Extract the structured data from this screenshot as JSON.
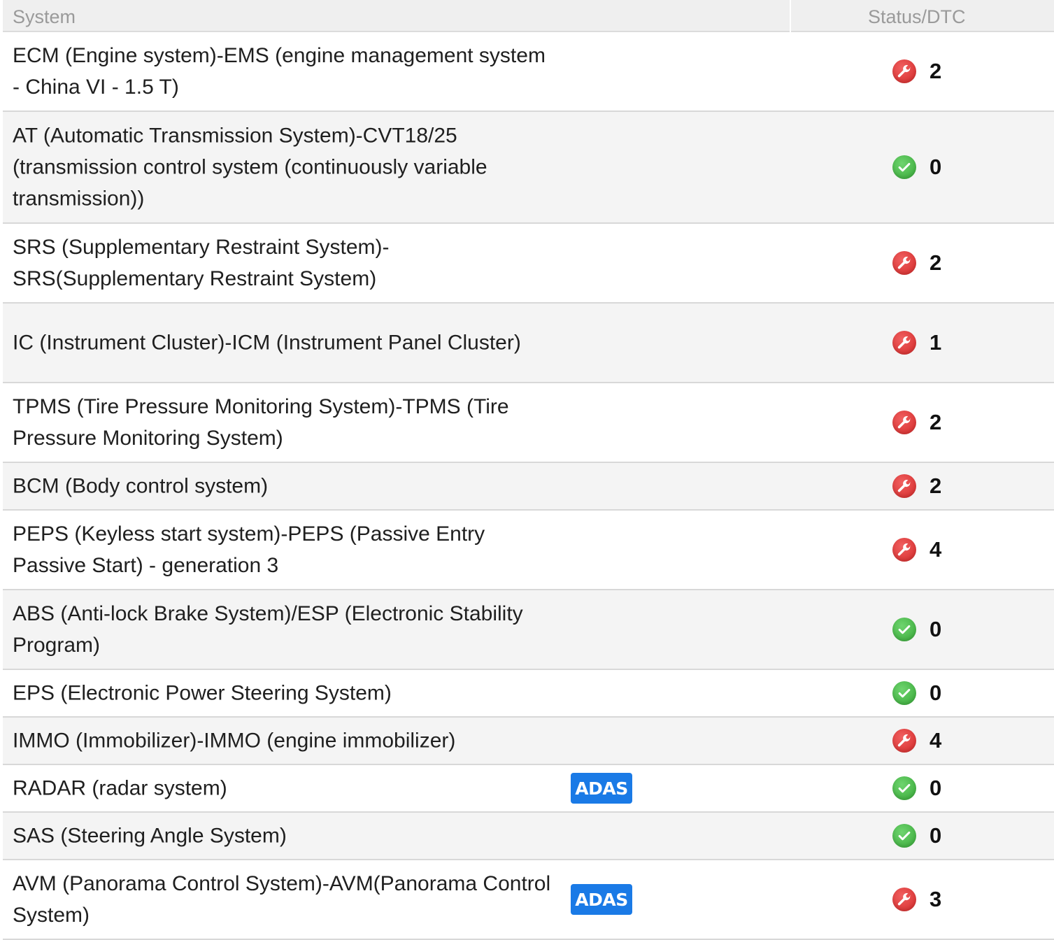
{
  "header": {
    "system_label": "System",
    "status_label": "Status/DTC"
  },
  "rows": [
    {
      "name": "ECM (Engine system)-EMS (engine management system - China VI - 1.5 T)",
      "status": "fault",
      "icon": "wrench-icon",
      "count": "2",
      "adas": ""
    },
    {
      "name": "AT (Automatic Transmission System)-CVT18/25 (transmission control system (continuously variable transmission))",
      "status": "ok",
      "icon": "check-icon",
      "count": "0",
      "adas": ""
    },
    {
      "name": "SRS (Supplementary Restraint System)-SRS(Supplementary Restraint System)",
      "status": "fault",
      "icon": "wrench-icon",
      "count": "2",
      "adas": ""
    },
    {
      "name": "IC (Instrument Cluster)-ICM (Instrument Panel Cluster)",
      "status": "fault",
      "icon": "wrench-icon",
      "count": "1",
      "adas": ""
    },
    {
      "name": "TPMS (Tire Pressure Monitoring System)-TPMS (Tire Pressure Monitoring System)",
      "status": "fault",
      "icon": "wrench-icon",
      "count": "2",
      "adas": ""
    },
    {
      "name": "BCM (Body control system)",
      "status": "fault",
      "icon": "wrench-icon",
      "count": "2",
      "adas": ""
    },
    {
      "name": "PEPS (Keyless start system)-PEPS (Passive Entry Passive Start) - generation 3",
      "status": "fault",
      "icon": "wrench-icon",
      "count": "4",
      "adas": ""
    },
    {
      "name": "ABS (Anti-lock Brake System)/ESP (Electronic Stability Program)",
      "status": "ok",
      "icon": "check-icon",
      "count": "0",
      "adas": ""
    },
    {
      "name": "EPS (Electronic Power Steering System)",
      "status": "ok",
      "icon": "check-icon",
      "count": "0",
      "adas": ""
    },
    {
      "name": "IMMO (Immobilizer)-IMMO (engine immobilizer)",
      "status": "fault",
      "icon": "wrench-icon",
      "count": "4",
      "adas": ""
    },
    {
      "name": "RADAR (radar system)",
      "status": "ok",
      "icon": "check-icon",
      "count": "0",
      "adas": "ADAS"
    },
    {
      "name": "SAS (Steering Angle System)",
      "status": "ok",
      "icon": "check-icon",
      "count": "0",
      "adas": ""
    },
    {
      "name": "AVM (Panorama Control System)-AVM(Panorama Control System)",
      "status": "fault",
      "icon": "wrench-icon",
      "count": "3",
      "adas": "ADAS"
    }
  ],
  "colors": {
    "fault": "#d42828",
    "ok": "#35a735",
    "adas": "#1a7ae6"
  }
}
